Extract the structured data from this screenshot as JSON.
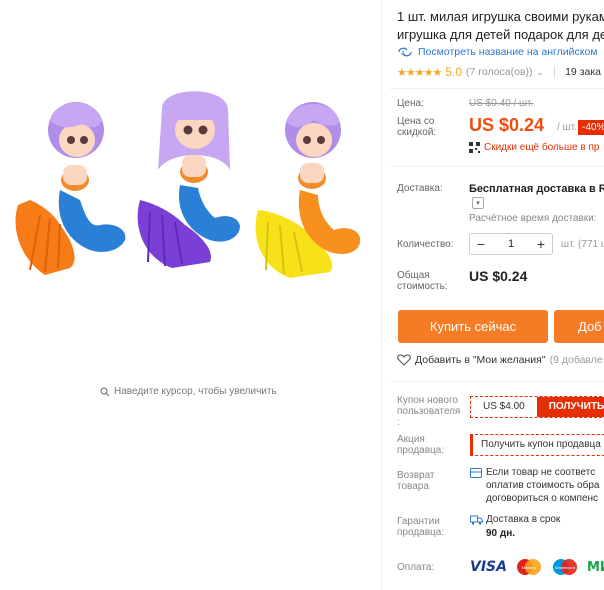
{
  "product": {
    "title_line1": "1 шт. милая игрушка своими рукам",
    "title_line2": "игрушка для детей подарок для де",
    "translate_link": "Посмотреть название на английском",
    "rating_value": "5.0",
    "votes": "(7 голоса(ов))",
    "orders": "19 зака",
    "stars": "★★★★★"
  },
  "gallery": {
    "zoom_hint": "Наведите курсор, чтобы увеличить"
  },
  "price": {
    "label": "Цена:",
    "old_value": "US $0.40 / шт.",
    "discount_label_line1": "Цена со",
    "discount_label_line2": "скидкой:",
    "new_value": "US $0.24",
    "per_unit": "/ шт.",
    "discount_badge": "-40%",
    "coupon_note": "Скидки ещё больше в пр",
    "colors": {
      "accent": "#f04d0f",
      "badge": "#e62e04"
    }
  },
  "shipping": {
    "label": "Доставка:",
    "method": "Бесплатная доставка в Rus",
    "estimate": "Расчётное время доставки:"
  },
  "quantity": {
    "label": "Количество:",
    "value": "1",
    "minus": "−",
    "plus": "+",
    "available": "шт. (771 ш"
  },
  "total": {
    "label_line1": "Общая",
    "label_line2": "стоимость:",
    "value": "US $0.24"
  },
  "actions": {
    "buy_now": "Купить сейчас",
    "add_to_cart": "Доб",
    "wishlist": "Добавить в \"Мои желания\"",
    "wishlist_count": "(9 добавле"
  },
  "coupon": {
    "label_line1": "Купон нового",
    "label_line2": "пользователя",
    "label_line3": ":",
    "amount": "US $4.00",
    "get": "ПОЛУЧИТЬ"
  },
  "seller_promo": {
    "label_line1": "Акция",
    "label_line2": "продавца:",
    "text": "Получить купон продавца"
  },
  "returns": {
    "label_line1": "Возврат",
    "label_line2": "товара",
    "text_line1": "Если товар не соответс",
    "text_line2": "оплатив стоимость обра",
    "text_line3": "договориться о компенс"
  },
  "guarantee": {
    "label_line1": "Гарантии",
    "label_line2": "продавца:",
    "text": "Доставка в срок",
    "days": "90 дн."
  },
  "payment": {
    "label": "Оплата:",
    "methods": [
      "VISA",
      "Maestro",
      "Mastercard",
      "MIR"
    ]
  }
}
